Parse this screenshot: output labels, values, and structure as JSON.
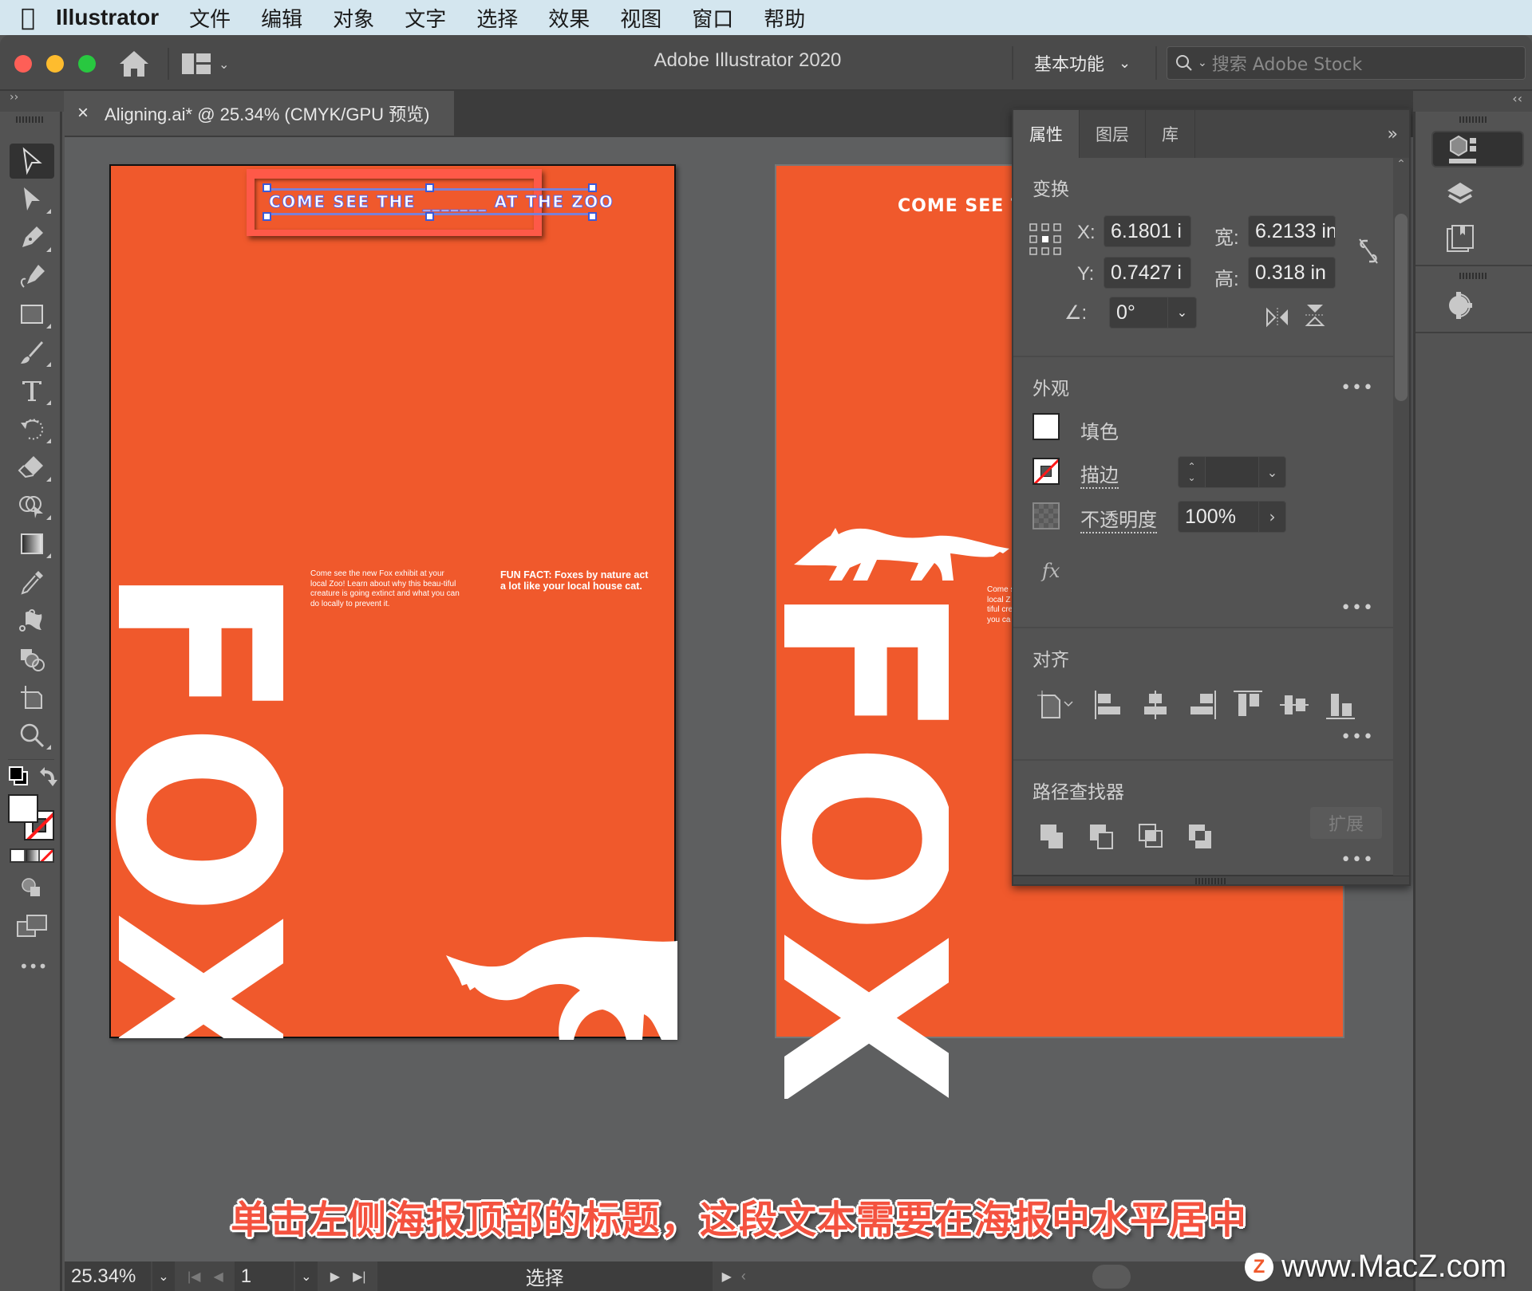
{
  "menubar": {
    "app_name": "Illustrator",
    "items": [
      "文件",
      "编辑",
      "对象",
      "文字",
      "选择",
      "效果",
      "视图",
      "窗口",
      "帮助"
    ]
  },
  "titlebar": {
    "title": "Adobe Illustrator 2020",
    "workspace": "基本功能",
    "search_placeholder": "搜索 Adobe Stock"
  },
  "document_tab": {
    "close": "×",
    "label": "Aligning.ai* @ 25.34% (CMYK/GPU 预览)"
  },
  "toolbar": {
    "collapse": "››",
    "tools": [
      "selection",
      "direct-selection",
      "pen",
      "curvature",
      "rectangle",
      "paintbrush",
      "type",
      "rotate",
      "eraser",
      "shape-builder",
      "gradient",
      "eyedropper",
      "puppet-warp",
      "live-paint",
      "artboard",
      "zoom"
    ],
    "more": "•••"
  },
  "left_poster": {
    "headline": "COME SEE THE _______ AT THE ZOO",
    "big_word": [
      "F",
      "O",
      "X"
    ],
    "body": "Come see the new Fox exhibit at your local Zoo! Learn about why this beau-tiful creature is going extinct and what you can do locally to prevent it.",
    "fun_fact": "FUN FACT: Foxes by nature act a lot like your local house cat.",
    "color": "#f0592c"
  },
  "right_poster": {
    "headline": "COME SEE TH",
    "big_word": [
      "F",
      "O",
      "X"
    ],
    "body_lines": [
      "Come s",
      "local Z",
      "tiful cre",
      "you ca"
    ]
  },
  "properties_panel": {
    "tabs": [
      {
        "label": "属性",
        "active": true
      },
      {
        "label": "图层",
        "active": false
      },
      {
        "label": "库",
        "active": false
      }
    ],
    "collapse": "»",
    "transform": {
      "title": "变换",
      "x_label": "X:",
      "x_value": "6.1801 i",
      "y_label": "Y:",
      "y_value": "0.7427 i",
      "w_label": "宽:",
      "w_value": "6.2133 in",
      "h_label": "高:",
      "h_value": "0.318 in",
      "angle_label": "∠:",
      "angle_value": "0°"
    },
    "appearance": {
      "title": "外观",
      "fill_label": "填色",
      "stroke_label": "描边",
      "opacity_label": "不透明度",
      "opacity_value": "100%",
      "fx": "fx"
    },
    "align": {
      "title": "对齐",
      "buttons": [
        "align-to",
        "horizontal-align-left",
        "horizontal-align-center",
        "horizontal-align-right",
        "vertical-align-top",
        "vertical-align-center",
        "vertical-align-bottom"
      ]
    },
    "pathfinder": {
      "title": "路径查找器",
      "buttons": [
        "unite",
        "minus-front",
        "intersect",
        "exclude"
      ],
      "expand": "扩展"
    },
    "more": "•••"
  },
  "dock": {
    "collapse": "‹‹",
    "items": [
      "properties",
      "layers",
      "libraries",
      "cc-libraries-sync"
    ]
  },
  "caption": "单击左侧海报顶部的标题，这段文本需要在海报中水平居中",
  "statusbar": {
    "zoom": "25.34%",
    "artboard": "1",
    "tool": "选择"
  },
  "watermark": {
    "logo": "Z",
    "text": "www.MacZ.com"
  }
}
